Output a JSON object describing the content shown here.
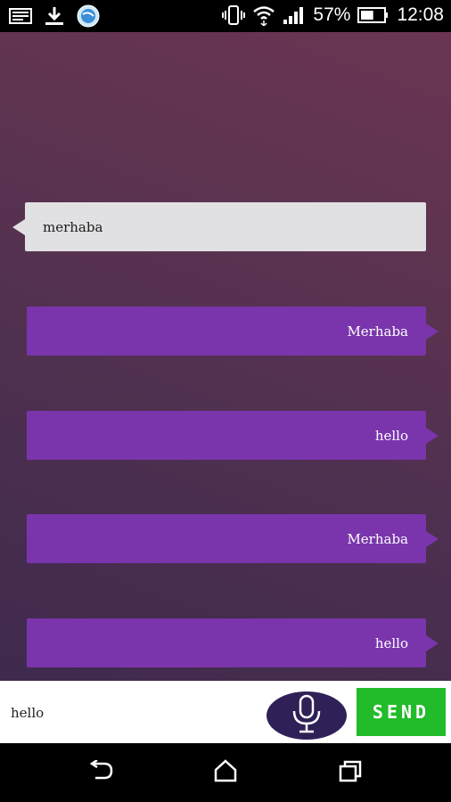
{
  "status_bar": {
    "left_icons": [
      "screenshot-icon",
      "download-icon",
      "browser-globe-icon"
    ],
    "right_icons": [
      "vibrate-icon",
      "wifi-icon",
      "signal-icon",
      "battery-icon"
    ],
    "battery_percent": "57%",
    "battery_level": 0.57,
    "time": "12:08"
  },
  "chat": {
    "messages": [
      {
        "direction": "incoming",
        "text": "merhaba"
      },
      {
        "direction": "outgoing",
        "text": "Merhaba"
      },
      {
        "direction": "outgoing",
        "text": "hello"
      },
      {
        "direction": "outgoing",
        "text": "Merhaba"
      },
      {
        "direction": "outgoing",
        "text": "hello"
      }
    ]
  },
  "input_bar": {
    "message_value": "hello",
    "mic_icon": "microphone-icon",
    "send_label": "SEND"
  },
  "nav_bar": {
    "icons": [
      "back-icon",
      "home-icon",
      "recents-icon"
    ]
  },
  "colors": {
    "incoming_bubble": "#e1e0e3",
    "outgoing_bubble": "#7a35ad",
    "mic_button": "#2f2157",
    "send_button": "#22bb2a"
  }
}
